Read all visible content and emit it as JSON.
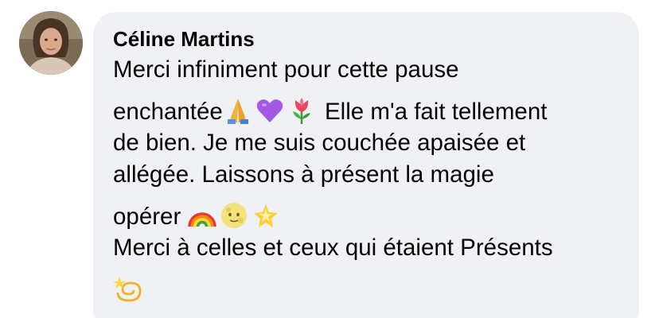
{
  "comment": {
    "author": "Céline Martins",
    "lines": [
      "Merci infiniment pour cette pause",
      "enchantée",
      " Elle m'a fait tellement",
      "de bien. Je me suis couchée apaisée et",
      "allégée. Laissons à présent la magie",
      "opérer ",
      "Merci à celles et ceux qui étaient Présents"
    ],
    "emojis": {
      "line2": [
        "folded-hands-icon",
        "purple-heart-icon",
        "tulip-icon"
      ],
      "line6": [
        "rainbow-icon",
        "full-moon-face-icon",
        "glowing-star-icon"
      ],
      "line8": [
        "dizzy-icon"
      ]
    }
  },
  "colors": {
    "bubble_bg": "#eff1f4",
    "text": "#050505"
  }
}
